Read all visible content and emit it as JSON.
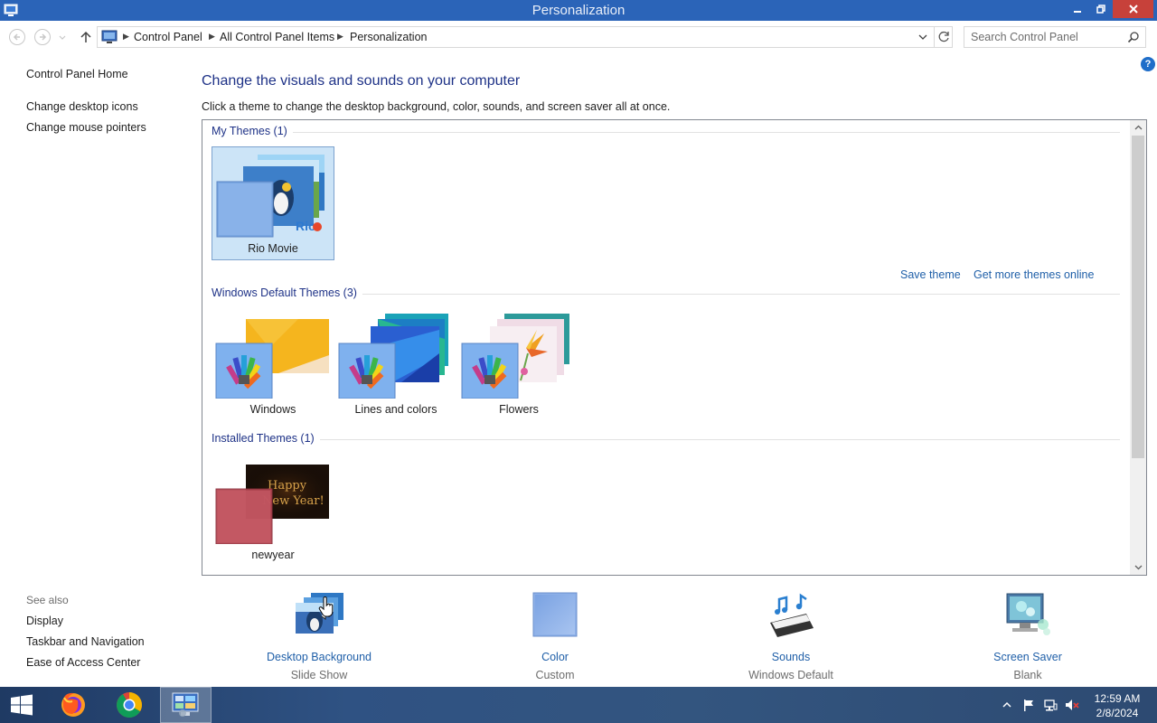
{
  "window": {
    "title": "Personalization"
  },
  "address": {
    "crumbs": [
      "Control Panel",
      "All Control Panel Items",
      "Personalization"
    ],
    "search_placeholder": "Search Control Panel"
  },
  "left_pane": {
    "home": "Control Panel Home",
    "links": [
      "Change desktop icons",
      "Change mouse pointers"
    ],
    "see_also_title": "See also",
    "see_also": [
      "Display",
      "Taskbar and Navigation",
      "Ease of Access Center"
    ]
  },
  "main": {
    "heading": "Change the visuals and sounds on your computer",
    "subheading": "Click a theme to change the desktop background, color, sounds, and screen saver all at once."
  },
  "themes": {
    "my_themes_label": "My Themes (1)",
    "my_themes": [
      {
        "name": "Rio Movie",
        "selected": true
      }
    ],
    "save_theme": "Save theme",
    "get_more": "Get more themes online",
    "default_label": "Windows Default Themes (3)",
    "default_themes": [
      {
        "name": "Windows"
      },
      {
        "name": "Lines and colors"
      },
      {
        "name": "Flowers"
      }
    ],
    "installed_label": "Installed Themes (1)",
    "installed_themes": [
      {
        "name": "newyear",
        "thumb_text_1": "Happy",
        "thumb_text_2": "New Year!"
      }
    ],
    "rio_logo_text": "Rio"
  },
  "settings": [
    {
      "label": "Desktop Background",
      "value": "Slide Show",
      "icon": "desktop-background-icon"
    },
    {
      "label": "Color",
      "value": "Custom",
      "icon": "color-swatch-icon"
    },
    {
      "label": "Sounds",
      "value": "Windows Default",
      "icon": "sounds-icon"
    },
    {
      "label": "Screen Saver",
      "value": "Blank",
      "icon": "screen-saver-icon"
    }
  ],
  "taskbar": {
    "apps": [
      "windows-start-icon",
      "firefox-icon",
      "chrome-icon",
      "control-panel-icon"
    ],
    "time": "12:59 AM",
    "date": "2/8/2024"
  },
  "colors": {
    "titlebar": "#2b64b8",
    "close": "#c7413a",
    "link": "#1f5fa8",
    "heading": "#1e3287",
    "selected": "#cce4f7"
  }
}
